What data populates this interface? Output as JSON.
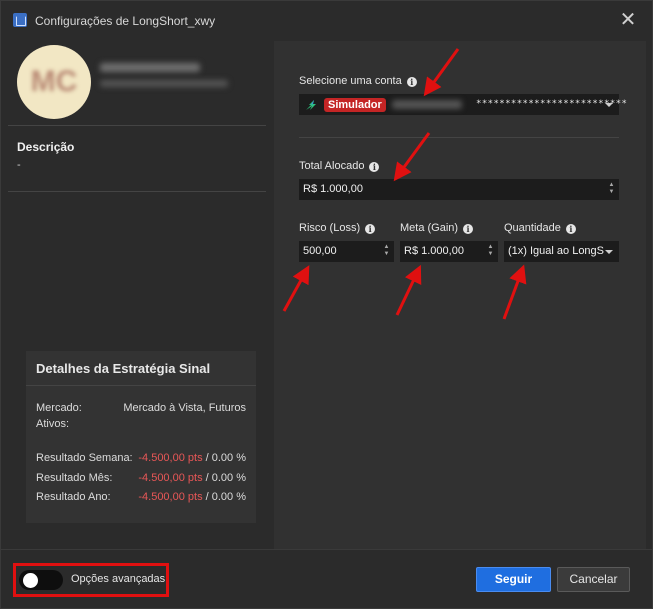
{
  "window": {
    "title": "Configurações de LongShort_xwy",
    "close_symbol": "✕"
  },
  "profile": {
    "avatar_initials": "MC"
  },
  "description": {
    "title": "Descrição",
    "value": "-"
  },
  "details": {
    "title": "Detalhes da Estratégia Sinal",
    "market_label": "Mercado:",
    "market_value": "Mercado à Vista, Futuros",
    "assets_label": "Ativos:",
    "rows": [
      {
        "label": "Resultado Semana:",
        "pts": "-4.500,00 pts",
        "pct": "/ 0.00 %"
      },
      {
        "label": "Resultado Mês:",
        "pts": "-4.500,00 pts",
        "pct": "/ 0.00 %"
      },
      {
        "label": "Resultado Ano:",
        "pts": "-4.500,00 pts",
        "pct": "/ 0.00 %"
      }
    ]
  },
  "form": {
    "account_label": "Selecione uma conta",
    "account_badge": "Simulador",
    "account_mask": "**************************",
    "allocated_label": "Total Alocado",
    "allocated_value": "R$ 1.000,00",
    "risk_label": "Risco (Loss)",
    "risk_value": "500,00",
    "goal_label": "Meta (Gain)",
    "goal_value": "R$ 1.000,00",
    "qty_label": "Quantidade",
    "qty_value": "(1x) Igual ao LongS"
  },
  "footer": {
    "advanced_label": "Opções avançadas",
    "advanced_enabled": false,
    "submit_label": "Seguir",
    "cancel_label": "Cancelar"
  },
  "colors": {
    "accent": "#1f6ee0",
    "negative": "#e85757",
    "badge": "#c42525",
    "annotation": "#e01010"
  },
  "icons": [
    "app-icon",
    "close-icon",
    "info-icon",
    "account-type-icon",
    "chevron-down-icon",
    "spinner-icon",
    "arrow-annotation-icon"
  ]
}
